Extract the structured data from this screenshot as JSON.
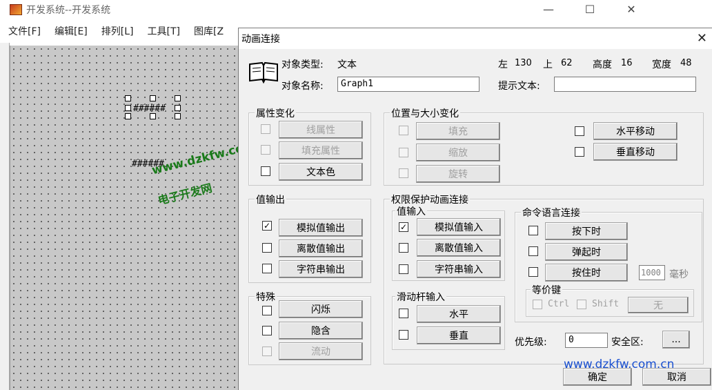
{
  "background_window": {
    "title": "开发系统--开发系统",
    "menu": [
      "文件[F]",
      "编辑[E]",
      "排列[L]",
      "工具[T]",
      "图库[Z"
    ],
    "canvas": {
      "objects": [
        {
          "text": "######"
        },
        {
          "text": "######."
        }
      ]
    },
    "watermark_lines": [
      "www.dzkfw.com.cn",
      "电子开发网"
    ],
    "controls": {
      "minimize": "—",
      "maximize": "☐",
      "close": "✕"
    }
  },
  "dialog": {
    "title": "动画连接",
    "close": "✕",
    "object_type_label": "对象类型:",
    "object_type_value": "文本",
    "left_label": "左",
    "left_value": "130",
    "top_label": "上",
    "top_value": "62",
    "height_label": "高度",
    "height_value": "16",
    "width_label": "宽度",
    "width_value": "48",
    "object_name_label": "对象名称:",
    "object_name_value": "Graph1",
    "hint_label": "提示文本:",
    "hint_value": "",
    "groups": {
      "attr": {
        "title": "属性变化",
        "items": [
          {
            "label": "线属性",
            "checked": false,
            "enabled": false
          },
          {
            "label": "填充属性",
            "checked": false,
            "enabled": false
          },
          {
            "label": "文本色",
            "checked": false,
            "enabled": true
          }
        ]
      },
      "pos": {
        "title": "位置与大小变化",
        "items": [
          {
            "label": "填充",
            "checked": false,
            "enabled": false
          },
          {
            "label": "缩放",
            "checked": false,
            "enabled": false
          },
          {
            "label": "旋转",
            "checked": false,
            "enabled": false
          },
          {
            "label": "水平移动",
            "checked": false,
            "enabled": true
          },
          {
            "label": "垂直移动",
            "checked": false,
            "enabled": true
          }
        ]
      },
      "output": {
        "title": "值输出",
        "items": [
          {
            "label": "模拟值输出",
            "checked": true,
            "mark": "✓",
            "enabled": true
          },
          {
            "label": "离散值输出",
            "checked": false,
            "enabled": true
          },
          {
            "label": "字符串输出",
            "checked": false,
            "enabled": true
          }
        ]
      },
      "special": {
        "title": "特殊",
        "items": [
          {
            "label": "闪烁",
            "checked": false,
            "enabled": true
          },
          {
            "label": "隐含",
            "checked": false,
            "enabled": true
          },
          {
            "label": "流动",
            "checked": false,
            "enabled": false
          }
        ]
      },
      "perm": {
        "title": "权限保护动画连接",
        "input": {
          "title": "值输入",
          "items": [
            {
              "label": "模拟值输入",
              "checked": true,
              "mark": "✓",
              "enabled": true
            },
            {
              "label": "离散值输入",
              "checked": false,
              "enabled": true
            },
            {
              "label": "字符串输入",
              "checked": false,
              "enabled": true
            }
          ]
        },
        "slider": {
          "title": "滑动杆输入",
          "items": [
            {
              "label": "水平",
              "checked": false,
              "enabled": true
            },
            {
              "label": "垂直",
              "checked": false,
              "enabled": true
            }
          ]
        },
        "command": {
          "title": "命令语言连接",
          "items": [
            {
              "label": "按下时",
              "checked": false,
              "enabled": true
            },
            {
              "label": "弹起时",
              "checked": false,
              "enabled": true
            },
            {
              "label": "按住时",
              "checked": false,
              "enabled": true
            }
          ],
          "hold_value": "1000",
          "hold_unit": "毫秒",
          "hotkey": {
            "title": "等价键",
            "ctrl": "Ctrl",
            "shift": "Shift",
            "key": "无"
          }
        },
        "priority_label": "优先级:",
        "priority_value": "0",
        "security_label": "安全区:",
        "security_button": "..."
      }
    },
    "ok": "确定",
    "cancel": "取消",
    "watermark": "www.dzkfw.com.cn"
  }
}
